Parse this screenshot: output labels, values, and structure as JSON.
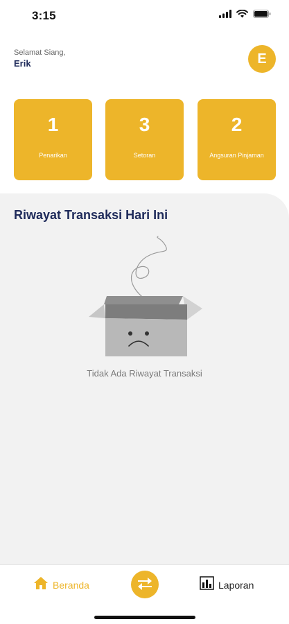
{
  "status_bar": {
    "time": "3:15",
    "icons": [
      "signal-icon",
      "wifi-icon",
      "battery-icon"
    ]
  },
  "header": {
    "greeting": "Selamat Siang,",
    "user_name": "Erik",
    "avatar_initial": "E"
  },
  "summary_cards": [
    {
      "count": "1",
      "label": "Penarikan"
    },
    {
      "count": "3",
      "label": "Setoran"
    },
    {
      "count": "2",
      "label": "Angsuran Pinjaman"
    }
  ],
  "history": {
    "title": "Riwayat Transaksi Hari Ini",
    "empty_message": "Tidak Ada Riwayat Transaksi",
    "illustration": "empty-box-icon"
  },
  "bottom_nav": {
    "home_label": "Beranda",
    "home_icon": "home-icon",
    "center_icon": "transfer-icon",
    "report_label": "Laporan",
    "report_icon": "bar-chart-icon"
  },
  "colors": {
    "accent": "#edb52a",
    "title": "#1e2a5a",
    "panel": "#f2f2f2"
  }
}
